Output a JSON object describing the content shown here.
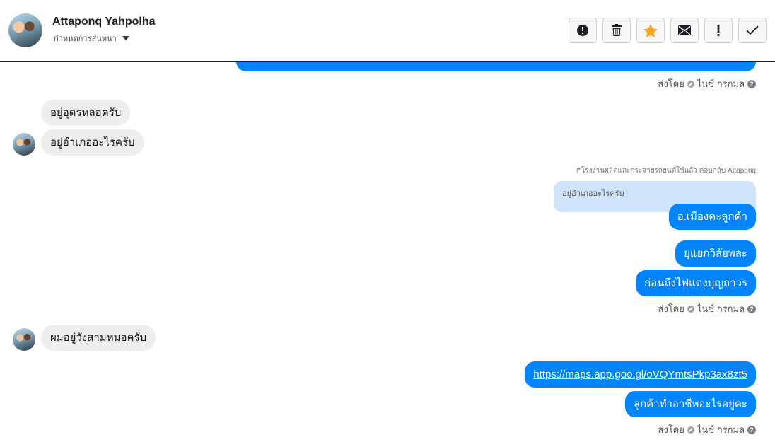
{
  "header": {
    "name": "Attaponq Yahpolha",
    "subtitle": "กำหนดการสนทนา"
  },
  "toolbar": {
    "buttons": [
      {
        "name": "alert-icon"
      },
      {
        "name": "trash-icon"
      },
      {
        "name": "star-icon",
        "color": "#f5a623"
      },
      {
        "name": "mail-icon"
      },
      {
        "name": "exclamation-icon"
      },
      {
        "name": "check-icon"
      }
    ]
  },
  "messages": {
    "sent_by_1": "ส่งโดย",
    "sender_1": "ไนซ์ กรกมล",
    "in_1": "อยู่อุดรหลอครับ",
    "in_2": "อยู่อำเภออะไรครับ",
    "reply_note": "โรงงานผลิตและกระจายรถยนต์ใช้แล้ว ตอบกลับ Attaponq",
    "quote_text": "อยู่อำเภออะไรครับ",
    "out_1": "อ.เมืองคะลูกค้า",
    "out_2": "ยุแยกวิลัยพละ",
    "out_3": "ก่อนถึงไฟแดงบุญถาวร",
    "sent_by_2": "ส่งโดย",
    "sender_2": "ไนซ์ กรกมล",
    "in_3": "ผมอยู่วังสามหมอครับ",
    "out_link": "https://maps.app.goo.gl/oVQYmtsPkp3ax8zt5",
    "out_4": "ลูกค้าทำอาชีพอะไรอยู่คะ",
    "sent_by_3": "ส่งโดย",
    "sender_3": "ไนซ์ กรกมล"
  },
  "colors": {
    "outgoing": "#0084ff",
    "incoming": "#eeeeee",
    "quote": "#cfe3fb"
  }
}
